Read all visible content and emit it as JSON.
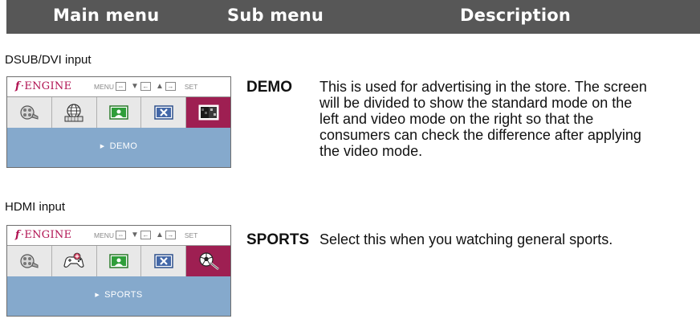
{
  "header": {
    "main_menu": "Main menu",
    "sub_menu": "Sub menu",
    "description": "Description"
  },
  "osd": {
    "logo_text": "ENGINE",
    "ctrl_menu": "MENU",
    "ctrl_set": "SET"
  },
  "sections": [
    {
      "input_label": "DSUB/DVI input",
      "selected_label": "DEMO",
      "term": "DEMO",
      "description_lines": [
        "This is used for advertising in the store. The screen",
        "will be divided to show the standard mode on the",
        "left and video mode on the right so that the",
        "consumers can check the difference after applying",
        "the video mode."
      ]
    },
    {
      "input_label": "HDMI input",
      "selected_label": "SPORTS",
      "term": "SPORTS",
      "description_lines": [
        "Select this when you watching general sports."
      ]
    }
  ],
  "colors": {
    "header_bg": "#575757",
    "selected_tile": "#9e1f52",
    "status_bar": "#85a9cc",
    "logo": "#b01050"
  }
}
